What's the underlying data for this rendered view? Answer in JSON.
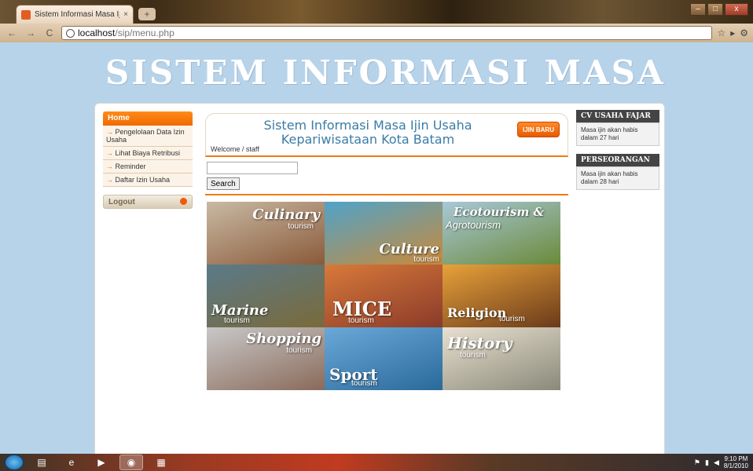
{
  "browser": {
    "tab_title": "Sistem Informasi Masa Iji...",
    "tab_close": "×",
    "new_tab": "+",
    "url_host": "localhost",
    "url_path": "/sip/menu.php",
    "back": "←",
    "forward": "→",
    "reload": "C",
    "star": "☆",
    "window_controls": {
      "minimize": "–",
      "maximize": "□",
      "close": "x"
    }
  },
  "banner": {
    "text": "SISTEM INFORMASI MASA IJIN USAHA KEPA"
  },
  "leftnav": {
    "home": "Home",
    "items": [
      {
        "label": "Pengelolaan Data Izin Usaha"
      },
      {
        "label": "Lihat Biaya Retribusi"
      },
      {
        "label": "Reminder"
      },
      {
        "label": "Daftar Izin Usaha"
      }
    ],
    "arrow": "→",
    "logout": "Logout"
  },
  "main": {
    "title": "Sistem Informasi Masa Ijin Usaha Kepariwisataan Kota Batam",
    "izin_button": "IJIN BARU",
    "welcome": "Welcome / staff",
    "search_value": "",
    "search_button": "Search"
  },
  "tiles": [
    {
      "t1": "Culinary",
      "t2": "tourism",
      "colors": [
        "#c9b9a3",
        "#8a5a3a"
      ]
    },
    {
      "t1": "Culture",
      "t2": "tourism",
      "colors": [
        "#4fa3c9",
        "#c98a3a"
      ]
    },
    {
      "t1": "Ecotourism &",
      "t2": "Agrotourism",
      "colors": [
        "#a8c8d8",
        "#6a8a3a"
      ]
    },
    {
      "t1": "Marine",
      "t2": "tourism",
      "colors": [
        "#5a7a8a",
        "#7a6a3a"
      ]
    },
    {
      "t1": "MICE",
      "t2": "tourism",
      "colors": [
        "#d87a3a",
        "#8a3a2a"
      ]
    },
    {
      "t1": "Religion",
      "t2": "tourism",
      "colors": [
        "#e8a23a",
        "#6a3a1a"
      ]
    },
    {
      "t1": "Shopping",
      "t2": "tourism",
      "colors": [
        "#c8c8c8",
        "#8a6a5a"
      ]
    },
    {
      "t1": "Sport",
      "t2": "tourism",
      "colors": [
        "#6aa8d8",
        "#2a6a9a"
      ]
    },
    {
      "t1": "History",
      "t2": "tourism",
      "colors": [
        "#e8e0d0",
        "#8a8a7a"
      ]
    }
  ],
  "sidebar": [
    {
      "title": "CV USAHA FAJAR",
      "body": "Masa ijin akan habis dalam 27 hari"
    },
    {
      "title": "PERSEORANGAN",
      "body": "Masa ijin akan habis dalam 28 hari"
    }
  ],
  "taskbar": {
    "time": "9:10 PM",
    "date": "8/1/2010"
  }
}
